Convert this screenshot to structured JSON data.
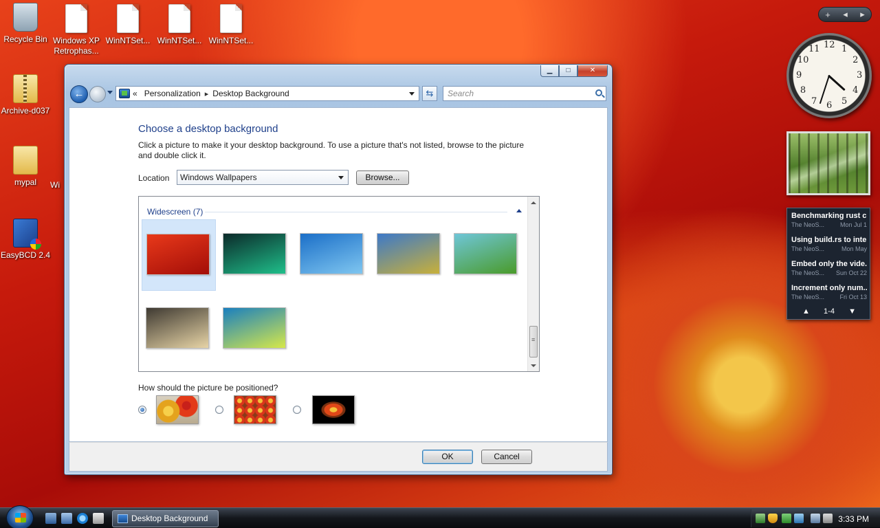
{
  "desktop": {
    "icons": [
      {
        "label": "Recycle Bin",
        "icon": "recycle-bin-icon"
      },
      {
        "label": "Windows XP Retrophas...",
        "icon": "file-icon"
      },
      {
        "label": "WinNTSet...",
        "icon": "file-icon"
      },
      {
        "label": "WinNTSet...",
        "icon": "file-icon"
      },
      {
        "label": "WinNTSet...",
        "icon": "file-icon"
      },
      {
        "label": "Archive-d037",
        "icon": "zip-folder-icon"
      },
      {
        "label": "mypal",
        "icon": "folder-icon"
      },
      {
        "label": "Wi",
        "icon": "file-icon"
      },
      {
        "label": "EasyBCD 2.4",
        "icon": "app-icon"
      }
    ]
  },
  "window": {
    "title": "Desktop Background",
    "controls": {
      "minimize": "▁",
      "maximize": "□",
      "close": "✕"
    },
    "breadcrumb": {
      "root": "«",
      "items": [
        "Personalization",
        "Desktop Background"
      ]
    },
    "search_placeholder": "Search",
    "heading": "Choose a desktop background",
    "description": "Click a picture to make it your desktop background. To use a picture that's not listed, browse to the picture and double click it.",
    "location_label": "Location",
    "location_value": "Windows Wallpapers",
    "browse_label": "Browse...",
    "gallery": {
      "group_label": "Widescreen (7)",
      "selected_index": 0,
      "thumbnails": [
        {
          "name": "red-flower-wallpaper",
          "colors": [
            "#e8391a",
            "#a30e08"
          ]
        },
        {
          "name": "aurora-wallpaper",
          "colors": [
            "#0c2a2a",
            "#1fbf8a"
          ]
        },
        {
          "name": "fish-wallpaper",
          "colors": [
            "#1b6fc8",
            "#7fc6f0"
          ]
        },
        {
          "name": "hills-wallpaper",
          "colors": [
            "#3d79c8",
            "#c8b03a"
          ]
        },
        {
          "name": "palm-leaf-wallpaper",
          "colors": [
            "#6fc6d8",
            "#4a9b2a"
          ]
        },
        {
          "name": "mountain-lake-wallpaper",
          "colors": [
            "#3f3a32",
            "#e7d4a6"
          ]
        },
        {
          "name": "vista-aurora-wallpaper",
          "colors": [
            "#1a7fbf",
            "#d6e84a"
          ]
        }
      ]
    },
    "position_label": "How should the picture be positioned?",
    "position_options": [
      {
        "name": "fit-to-screen",
        "checked": true
      },
      {
        "name": "tile",
        "checked": false
      },
      {
        "name": "center",
        "checked": false
      }
    ],
    "ok_label": "OK",
    "cancel_label": "Cancel"
  },
  "gadgets": {
    "toolbar": {
      "add": "+",
      "prev": "◂",
      "next": "▸"
    },
    "clock": {
      "numbers": [
        "12",
        "1",
        "2",
        "3",
        "4",
        "5",
        "6",
        "7",
        "8",
        "9",
        "10",
        "11"
      ],
      "hour_angle": 132,
      "minute_angle": 198
    },
    "feed": {
      "items": [
        {
          "title": "Benchmarking rust c...",
          "source": "The NeoS...",
          "date": "Mon Jul 1"
        },
        {
          "title": "Using build.rs to inte...",
          "source": "The NeoS...",
          "date": "Mon May"
        },
        {
          "title": "Embed only the vide...",
          "source": "The NeoS...",
          "date": "Sun Oct 22"
        },
        {
          "title": "Increment only num...",
          "source": "The NeoS...",
          "date": "Fri Oct 13"
        }
      ],
      "pager": "1-4"
    }
  },
  "taskbar": {
    "quick_launch": [
      "show-desktop-icon",
      "switch-windows-icon",
      "internet-explorer-icon",
      "media-icon"
    ],
    "task_button_label": "Desktop Background",
    "time": "3:33 PM"
  }
}
